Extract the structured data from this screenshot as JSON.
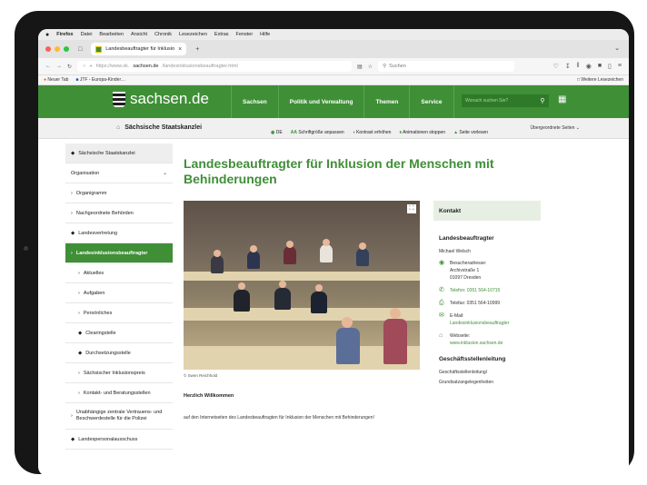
{
  "menubar": {
    "apple": "",
    "app": "Firefox",
    "items": [
      "Datei",
      "Bearbeiten",
      "Ansicht",
      "Chronik",
      "Lesezeichen",
      "Extras",
      "Fenster",
      "Hilfe"
    ]
  },
  "tab": {
    "title": "Landesbeauftragter für Inklusio"
  },
  "address": {
    "prefix": "https://www.sk.",
    "domain": "sachsen.de",
    "path": "/landesinklusionsbeauftragter.html",
    "search_placeholder": "Suchen"
  },
  "bookmarks": {
    "items": [
      "Neuer Tab",
      "JTF - Europa-Kinder…"
    ],
    "other": "Weitere Lesezeichen"
  },
  "site": {
    "logo": "sachsen.de",
    "nav": [
      "Sachsen",
      "Politik und Verwaltung",
      "Themen",
      "Service"
    ],
    "search_placeholder": "Wonach suchen Sie?"
  },
  "subheader": {
    "title": "Sächsische Staatskanzlei",
    "parent": "Übergeordnete Seiten"
  },
  "tools": {
    "lang": "DE",
    "font": "Schriftgröße anpassen",
    "contrast": "Kontrast erhöhen",
    "anim": "Animationen stoppen",
    "read": "Seite vorlesen"
  },
  "sidebar": {
    "items": [
      {
        "label": "Sächsische Staatskanzlei",
        "kind": "top"
      },
      {
        "label": "Organisation",
        "kind": "org"
      },
      {
        "label": "Organigramm",
        "kind": "link"
      },
      {
        "label": "Nachgeordnete Behörden",
        "kind": "link"
      },
      {
        "label": "Landesvertretung",
        "kind": "link"
      },
      {
        "label": "Landesinklusionsbeauftragter",
        "kind": "active"
      },
      {
        "label": "Aktuelles",
        "kind": "sub"
      },
      {
        "label": "Aufgaben",
        "kind": "sub"
      },
      {
        "label": "Persönliches",
        "kind": "sub"
      },
      {
        "label": "Clearingstelle",
        "kind": "sub"
      },
      {
        "label": "Durchsetzungsstelle",
        "kind": "sub"
      },
      {
        "label": "Sächsischer Inklusionspreis",
        "kind": "sub"
      },
      {
        "label": "Kontakt- und Beratungsstellen",
        "kind": "sub"
      },
      {
        "label": "Unabhängige zentrale Vertrauens- und Beschwerdestelle für die Polizei",
        "kind": "two"
      },
      {
        "label": "Landespersonalausschuss",
        "kind": "link"
      }
    ]
  },
  "main": {
    "title": "Landesbeauftragter für Inklusion der Menschen mit Behinderungen",
    "caption": "© Swen Reichhold",
    "welcome": "Herzlich Willkommen",
    "text": "auf den Internetseiten des Landesbeauftragten für Inklusion der Menschen mit Behinderungen!"
  },
  "contact": {
    "header": "Kontakt",
    "title": "Landesbeauftragter",
    "name": "Michael Welsch",
    "address_label": "Besucheradresse:",
    "street": "Archivstraße 1",
    "city": "01097 Dresden",
    "phone": "Telefon: 0351 564-10715",
    "fax": "Telefax: 0351 564-10999",
    "email_label": "E-Mail:",
    "email": "Landesinklusionsbeauftragter",
    "web_label": "Webseite:",
    "web": "www.inklusion.sachsen.de",
    "office_title": "Geschäftsstellenleitung",
    "office_role": "Geschäftsstellenleitung/",
    "office_sub": "Grundsatzangelegenheiten"
  }
}
